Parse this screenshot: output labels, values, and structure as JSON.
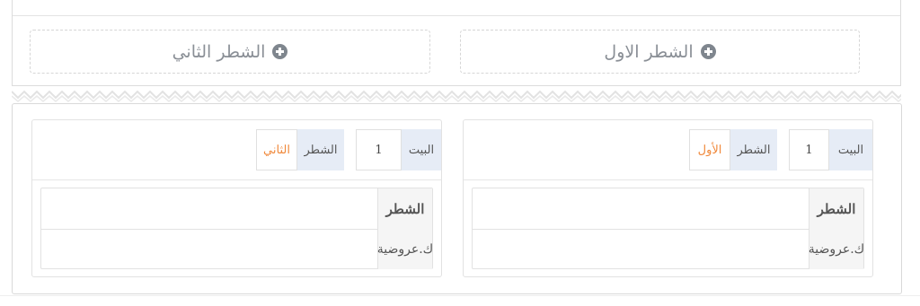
{
  "editor": {
    "add_first_label": "الشطر الاول",
    "add_second_label": "الشطر الثاني"
  },
  "verses": [
    {
      "bayt_label": "البيت",
      "bayt_number": "1",
      "shatr_label": "الشطر",
      "shatr_role": "الأول",
      "rows": [
        {
          "header": "الشطر",
          "value": ""
        },
        {
          "header": "ك.عروضية",
          "value": ""
        }
      ]
    },
    {
      "bayt_label": "البيت",
      "bayt_number": "1",
      "shatr_label": "الشطر",
      "shatr_role": "الثاني",
      "rows": [
        {
          "header": "الشطر",
          "value": ""
        },
        {
          "header": "ك.عروضية",
          "value": ""
        }
      ]
    }
  ],
  "colors": {
    "accent_orange": "#f0883a",
    "label_bg": "#e6ecf6",
    "icon_gray": "#7f868e"
  }
}
